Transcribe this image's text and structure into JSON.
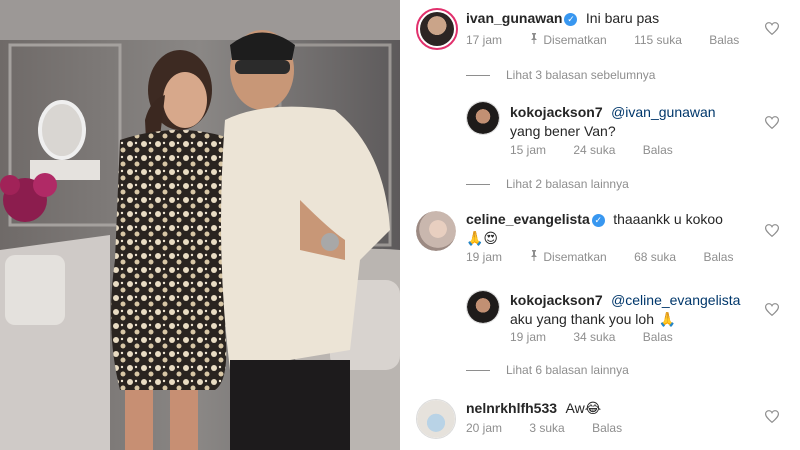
{
  "comments": [
    {
      "username": "ivan_gunawan",
      "verified": true,
      "text": "Ini baru pas",
      "time": "17 jam",
      "pinned_label": "Disematkan",
      "likes": "115 suka",
      "reply_label": "Balas"
    },
    {
      "view_replies": "Lihat 3 balasan sebelumnya"
    },
    {
      "username": "kokojackson7",
      "mention": "@ivan_gunawan",
      "text": "yang bener Van?",
      "time": "15 jam",
      "likes": "24 suka",
      "reply_label": "Balas"
    },
    {
      "view_replies": "Lihat 2 balasan lainnya"
    },
    {
      "username": "celine_evangelista",
      "verified": true,
      "text": "thaaankk u kokoo",
      "emojis": "🙏😍",
      "time": "19 jam",
      "pinned_label": "Disematkan",
      "likes": "68 suka",
      "reply_label": "Balas"
    },
    {
      "username": "kokojackson7",
      "mention": "@celine_evangelista",
      "text": "aku yang thank you loh",
      "emoji": "🙏",
      "time": "19 jam",
      "likes": "34 suka",
      "reply_label": "Balas"
    },
    {
      "view_replies": "Lihat 6 balasan lainnya"
    },
    {
      "username": "nelnrkhlfh533",
      "text": "Aw",
      "emoji": "😂",
      "time": "20 jam",
      "likes": "3 suka",
      "reply_label": "Balas"
    }
  ],
  "icons": {
    "like": "heart-outline-icon",
    "pin": "pin-icon",
    "verified": "verified-badge-icon"
  },
  "colors": {
    "link": "#00376b",
    "meta": "#8e8e8e",
    "verified": "#3897f0",
    "story_ring": "#e1306c"
  }
}
